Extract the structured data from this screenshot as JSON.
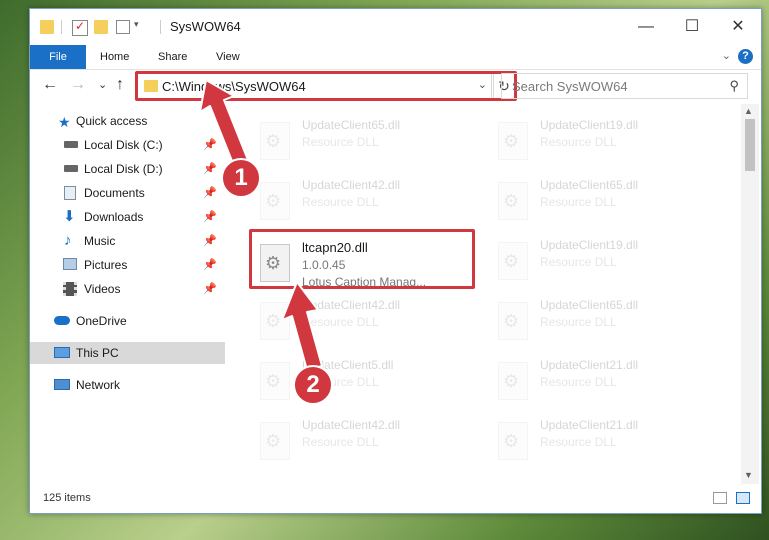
{
  "window": {
    "title": "SysWOW64",
    "controls": {
      "minimize": "—",
      "maximize": "☐",
      "close": "✕"
    }
  },
  "ribbon": {
    "tabs": [
      "File",
      "Home",
      "Share",
      "View"
    ],
    "help": "?"
  },
  "navigation": {
    "back": "←",
    "forward": "→",
    "recent": "⌄",
    "up": "↑",
    "address": "C:\\Windows\\SysWOW64",
    "refresh": "↻",
    "search_placeholder": "Search SysWOW64"
  },
  "sidebar": {
    "items": [
      {
        "label": "Quick access",
        "icon": "star-icon",
        "pinned": false
      },
      {
        "label": "Local Disk (C:)",
        "icon": "drive-icon",
        "pinned": true
      },
      {
        "label": "Local Disk (D:)",
        "icon": "drive-icon",
        "pinned": true
      },
      {
        "label": "Documents",
        "icon": "documents-icon",
        "pinned": true
      },
      {
        "label": "Downloads",
        "icon": "download-icon",
        "pinned": true
      },
      {
        "label": "Music",
        "icon": "music-icon",
        "pinned": true
      },
      {
        "label": "Pictures",
        "icon": "pictures-icon",
        "pinned": true
      },
      {
        "label": "Videos",
        "icon": "videos-icon",
        "pinned": true
      },
      {
        "label": "OneDrive",
        "icon": "cloud-icon",
        "pinned": false
      },
      {
        "label": "This PC",
        "icon": "computer-icon",
        "pinned": false,
        "selected": true
      },
      {
        "label": "Network",
        "icon": "network-icon",
        "pinned": false
      }
    ]
  },
  "files": {
    "left_column": [
      {
        "name": "UpdateClient65.dll",
        "type": "Resource DLL"
      },
      {
        "name": "UpdateClient42.dll",
        "type": "Resource DLL"
      },
      {
        "name": "ltcapn20.dll",
        "version": "1.0.0.45",
        "description": "Lotus Caption Manag...",
        "highlighted": true
      },
      {
        "name": "UpdateClient42.dll",
        "type": "Resource DLL"
      },
      {
        "name": "UpdateClient5.dll",
        "type": "Resource DLL"
      },
      {
        "name": "UpdateClient42.dll",
        "type": "Resource DLL"
      }
    ],
    "right_column": [
      {
        "name": "UpdateClient19.dll",
        "type": "Resource DLL"
      },
      {
        "name": "UpdateClient65.dll",
        "type": "Resource DLL"
      },
      {
        "name": "UpdateClient19.dll",
        "type": "Resource DLL"
      },
      {
        "name": "UpdateClient65.dll",
        "type": "Resource DLL"
      },
      {
        "name": "UpdateClient21.dll",
        "type": "Resource DLL"
      },
      {
        "name": "UpdateClient21.dll",
        "type": "Resource DLL"
      }
    ]
  },
  "status": {
    "item_count": "125 items"
  },
  "annotations": {
    "step1": "1",
    "step2": "2",
    "color": "#d0373e"
  }
}
